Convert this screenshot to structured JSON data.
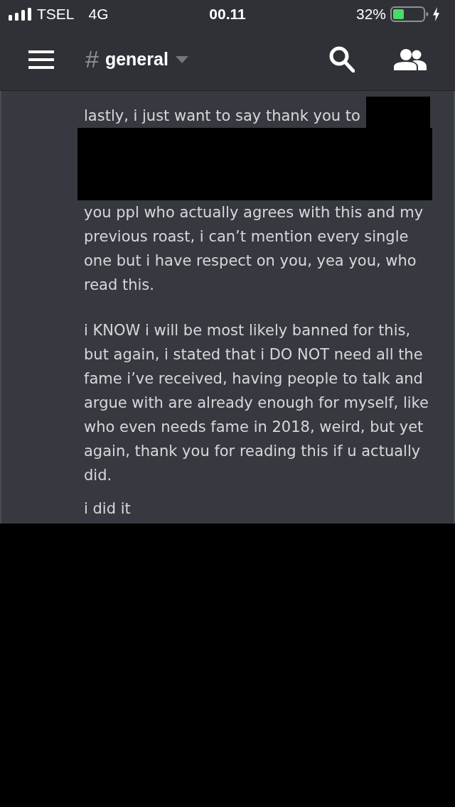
{
  "status_bar": {
    "carrier": "TSEL",
    "network": "4G",
    "time": "00.11",
    "battery": "32%",
    "charging": true
  },
  "header": {
    "channel_icon": "#",
    "channel": "general"
  },
  "messages": [
    {
      "paragraphs": [
        [
          {
            "kind": "text",
            "text": "lastly, i just want to say thank you to",
            "redacted_after": true
          },
          {
            "kind": "redaction"
          },
          {
            "kind": "text",
            "text": "you ppl who actually agrees with this and my previous roast, i can’t mention every single one but i have respect on you, yea you, who read this.",
            "redacted_after": false
          }
        ],
        [
          {
            "kind": "text",
            "text": "i KNOW i will be most likely banned for this, but again, i stated that i DO NOT need all the fame i’ve received, having people to talk and argue with are already enough for myself, like who even needs fame in 2018, weird, but yet again, thank you for reading this if u actually did.",
            "redacted_after": false
          }
        ]
      ]
    },
    {
      "paragraphs": [
        [
          {
            "kind": "text",
            "text": "i did it",
            "redacted_after": false
          }
        ]
      ]
    }
  ]
}
